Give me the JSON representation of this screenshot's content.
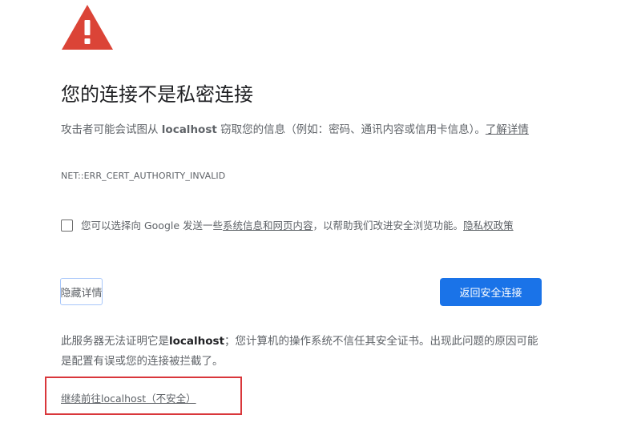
{
  "icon": {
    "name": "warning-triangle-icon",
    "color": "#db4437"
  },
  "title": "您的连接不是私密连接",
  "explanation": {
    "before": "攻击者可能会试图从 ",
    "host": "localhost",
    "after": " 窃取您的信息（例如：密码、通讯内容或信用卡信息）。",
    "learn_more": "了解详情"
  },
  "error_code": "NET::ERR_CERT_AUTHORITY_INVALID",
  "optin": {
    "checked": false,
    "before": "您可以选择向 Google 发送一些",
    "link": "系统信息和网页内容",
    "middle": "，以帮助我们改进安全浏览功能。",
    "privacy": "隐私权政策"
  },
  "buttons": {
    "details": "隐藏详情",
    "back": "返回安全连接"
  },
  "details": {
    "before": "此服务器无法证明它是",
    "host": "localhost",
    "after": "；您计算机的操作系统不信任其安全证书。出现此问题的原因可能是配置有误或您的连接被拦截了。"
  },
  "proceed_link": "继续前往localhost（不安全）",
  "colors": {
    "primary_button": "#1a73e8",
    "highlight_box": "#d9373b"
  }
}
